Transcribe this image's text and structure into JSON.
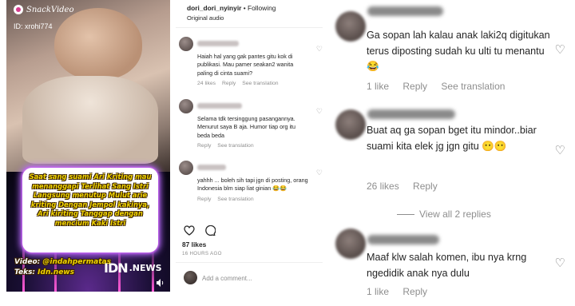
{
  "video": {
    "brand": "SnackVideo",
    "user_id": "ID: xrohi774",
    "caption": "Saat sang suami Ari Kriting mau menanggapi Terlihat Sang Istri Langsung menutup Mulut arie kriting Dengan Jempol kakinya, Ari kiriting Tanggap dengan mencium Kaki Istri",
    "credit_video_label": "Video:",
    "credit_video": "@indahpermatas",
    "credit_text_label": "Teks:",
    "credit_text": "Idn.news",
    "news_mark": "IDN",
    "news_label": ".NEWS"
  },
  "post": {
    "username": "dori_dori_nyinyir",
    "separator": " • ",
    "follow_status": "Following",
    "audio": "Original audio",
    "comments": [
      {
        "text": "Haiah hal yang gak pantes gitu kok di publikasi. Mau pamer seakan2 wanita paling di cinta suami?",
        "likes": "24 likes",
        "reply": "Reply",
        "see_translation": "See translation"
      },
      {
        "text": "Selama tdk tersinggung pasangannya. Menurut saya B aja. Humor tiap org itu beda beda",
        "reply": "Reply",
        "see_translation": "See translation"
      },
      {
        "text": "yahhh ... boleh sih tapi jgn di posting, orang Indonesia blm siap liat ginian 😂😂",
        "reply": "Reply",
        "see_translation": "See translation"
      }
    ],
    "likes_count": "87 likes",
    "time_ago": "16 HOURS AGO",
    "add_comment_placeholder": "Add a comment..."
  },
  "zoom": {
    "comments": [
      {
        "text": "Ga sopan lah kalau anak laki2q digitukan terus diposting sudah ku ulti tu menantu😂",
        "likes": "1 like",
        "reply": "Reply",
        "see_translation": "See translation"
      },
      {
        "text": "Buat aq ga sopan bget itu mindor..biar suami kita elek jg jgn gitu 😶😶",
        "likes": "26 likes",
        "reply": "Reply"
      },
      {
        "text": "Maaf klw salah komen, ibu nya krng ngedidik anak nya dulu",
        "likes": "1 like",
        "reply": "Reply"
      }
    ],
    "view_replies": "View all 2 replies"
  },
  "icons": [
    "snackvideo-logo-icon",
    "volume-icon",
    "heart-icon",
    "comment-icon"
  ]
}
